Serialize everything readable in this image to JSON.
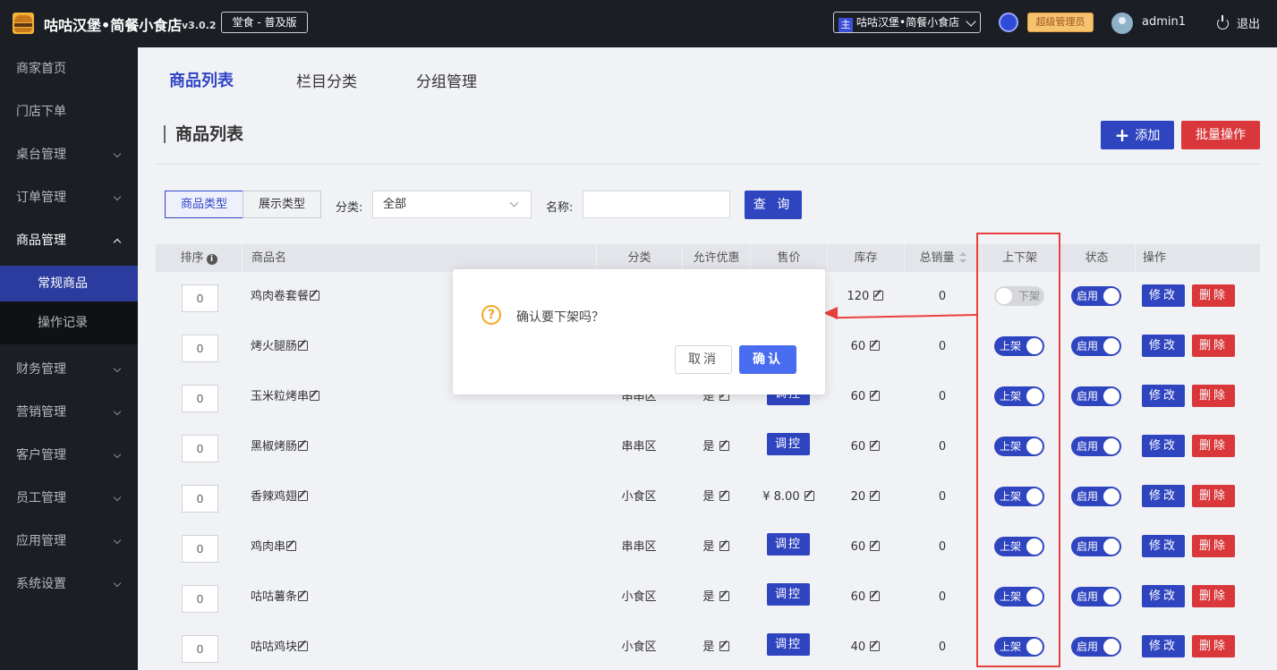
{
  "header": {
    "title": "咕咕汉堡•简餐小食店",
    "version": "v3.0.2",
    "edition": "堂食 - 普及版",
    "store_tag": "主",
    "store_name": "咕咕汉堡•简餐小食店",
    "role": "超级管理员",
    "username": "admin1",
    "logout": "退出"
  },
  "sidebar": {
    "items": [
      {
        "label": "商家首页"
      },
      {
        "label": "门店下单"
      },
      {
        "label": "桌台管理"
      },
      {
        "label": "订单管理"
      },
      {
        "label": "商品管理"
      },
      {
        "label": "财务管理"
      },
      {
        "label": "营销管理"
      },
      {
        "label": "客户管理"
      },
      {
        "label": "员工管理"
      },
      {
        "label": "应用管理"
      },
      {
        "label": "系统设置"
      }
    ],
    "sub_items": [
      {
        "label": "常规商品"
      },
      {
        "label": "操作记录"
      }
    ]
  },
  "tabs": [
    "商品列表",
    "栏目分类",
    "分组管理"
  ],
  "page": {
    "section_title": "商品列表",
    "add_label": "添加",
    "batch_label": "批量操作"
  },
  "filters": {
    "type_tab_1": "商品类型",
    "type_tab_2": "展示类型",
    "category_label": "分类:",
    "category_value": "全部",
    "name_label": "名称:",
    "name_value": "",
    "query_label": "查 询"
  },
  "table": {
    "columns": [
      "排序",
      "商品名",
      "分类",
      "允许优惠",
      "售价",
      "库存",
      "总销量",
      "上下架",
      "状态",
      "操作"
    ],
    "rows": [
      {
        "sort": "0",
        "name": "鸡肉卷套餐",
        "category": "",
        "discount": "",
        "price": "",
        "stock": "120",
        "sales": "0",
        "shelf": "下架",
        "shelf_on": false,
        "status": "启用",
        "edit": "修改",
        "delete": "删除"
      },
      {
        "sort": "0",
        "name": "烤火腿肠",
        "category": "",
        "discount": "",
        "price": "",
        "stock": "60",
        "sales": "0",
        "shelf": "上架",
        "shelf_on": true,
        "status": "启用",
        "edit": "修改",
        "delete": "删除"
      },
      {
        "sort": "0",
        "name": "玉米粒烤串",
        "category": "串串区",
        "discount": "是",
        "price": "调控",
        "stock": "60",
        "sales": "0",
        "shelf": "上架",
        "shelf_on": true,
        "status": "启用",
        "edit": "修改",
        "delete": "删除"
      },
      {
        "sort": "0",
        "name": "黑椒烤肠",
        "category": "串串区",
        "discount": "是",
        "price": "调控",
        "stock": "60",
        "sales": "0",
        "shelf": "上架",
        "shelf_on": true,
        "status": "启用",
        "edit": "修改",
        "delete": "删除"
      },
      {
        "sort": "0",
        "name": "香辣鸡翅",
        "category": "小食区",
        "discount": "是",
        "price": "¥ 8.00",
        "stock": "20",
        "sales": "0",
        "shelf": "上架",
        "shelf_on": true,
        "status": "启用",
        "edit": "修改",
        "delete": "删除"
      },
      {
        "sort": "0",
        "name": "鸡肉串",
        "category": "串串区",
        "discount": "是",
        "price": "调控",
        "stock": "60",
        "sales": "0",
        "shelf": "上架",
        "shelf_on": true,
        "status": "启用",
        "edit": "修改",
        "delete": "删除"
      },
      {
        "sort": "0",
        "name": "咕咕薯条",
        "category": "小食区",
        "discount": "是",
        "price": "调控",
        "stock": "60",
        "sales": "0",
        "shelf": "上架",
        "shelf_on": true,
        "status": "启用",
        "edit": "修改",
        "delete": "删除"
      },
      {
        "sort": "0",
        "name": "咕咕鸡块",
        "category": "小食区",
        "discount": "是",
        "price": "调控",
        "stock": "40",
        "sales": "0",
        "shelf": "上架",
        "shelf_on": true,
        "status": "启用",
        "edit": "修改",
        "delete": "删除"
      }
    ]
  },
  "dialog": {
    "message": "确认要下架吗？",
    "cancel": "取消",
    "confirm": "确认"
  },
  "colors": {
    "primary": "#2f45c0",
    "danger": "#d9373a",
    "highlight": "#e8413c",
    "warning": "#f5a623"
  }
}
